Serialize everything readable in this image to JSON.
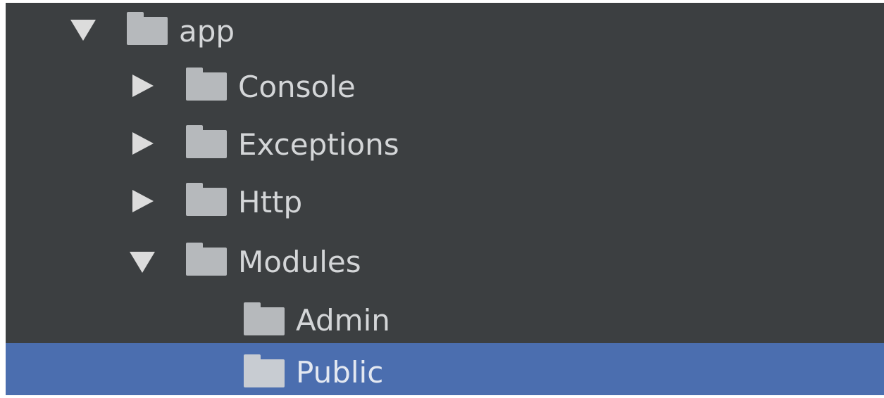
{
  "tree": {
    "items": [
      {
        "label": "app",
        "expanded": true,
        "icon": "folder-icon",
        "arrow": "chevron-down-icon"
      },
      {
        "label": "Console",
        "expanded": false,
        "icon": "folder-icon",
        "arrow": "chevron-right-icon"
      },
      {
        "label": "Exceptions",
        "expanded": false,
        "icon": "folder-icon",
        "arrow": "chevron-right-icon"
      },
      {
        "label": "Http",
        "expanded": false,
        "icon": "folder-icon",
        "arrow": "chevron-right-icon"
      },
      {
        "label": "Modules",
        "expanded": true,
        "icon": "folder-icon",
        "arrow": "chevron-down-icon"
      },
      {
        "label": "Admin",
        "icon": "folder-icon"
      },
      {
        "label": "Public",
        "icon": "folder-icon",
        "selected": true
      }
    ]
  },
  "colors": {
    "background": "#3c3f41",
    "selection": "#4b6eaf",
    "text": "#d4d6d8",
    "folder": "#b6b9bc"
  }
}
